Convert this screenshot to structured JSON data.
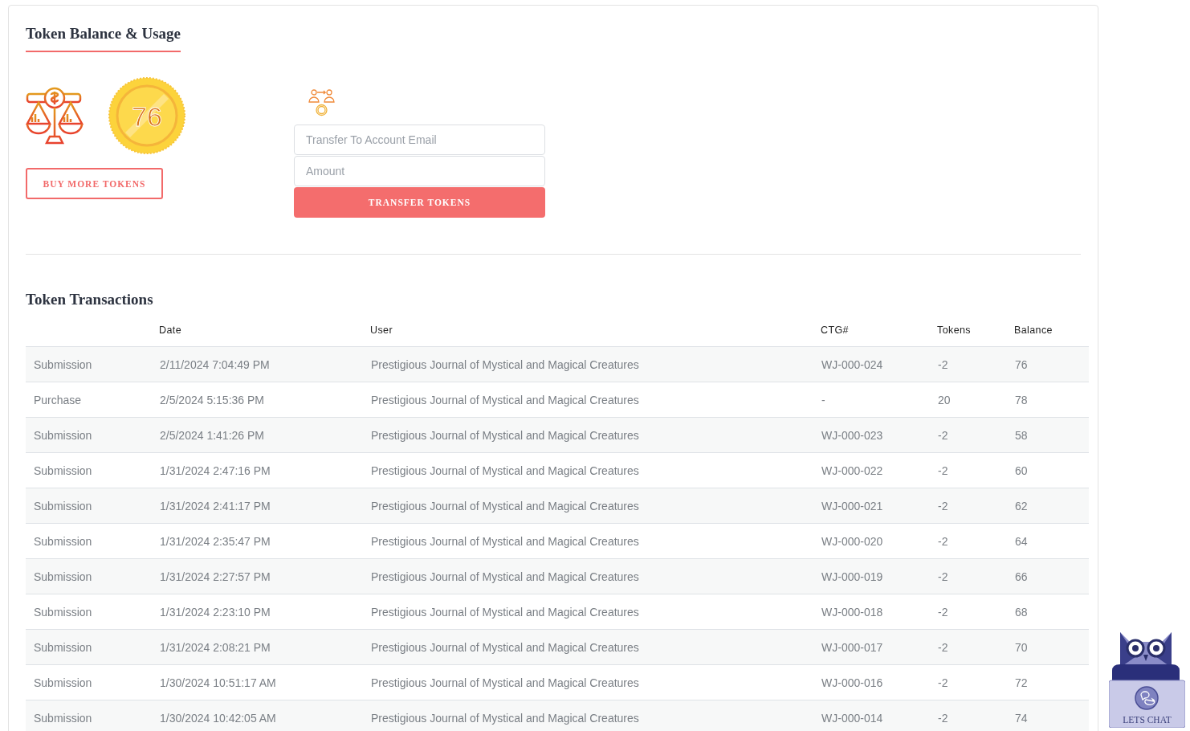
{
  "balance_section": {
    "title": "Token Balance & Usage",
    "balance": "76",
    "buy_button": "BUY MORE TOKENS"
  },
  "transfer": {
    "email_placeholder": "Transfer To Account Email",
    "amount_placeholder": "Amount",
    "button": "TRANSFER TOKENS"
  },
  "transactions": {
    "title": "Token Transactions",
    "columns": [
      "Date",
      "User",
      "CTG#",
      "Tokens",
      "Balance"
    ],
    "rows": [
      {
        "type": "Submission",
        "date": "2/11/2024 7:04:49 PM",
        "user": "Prestigious Journal of Mystical and Magical Creatures",
        "ctg": "WJ-000-024",
        "tokens": "-2",
        "balance": "76"
      },
      {
        "type": "Purchase",
        "date": "2/5/2024 5:15:36 PM",
        "user": "Prestigious Journal of Mystical and Magical Creatures",
        "ctg": "-",
        "tokens": "20",
        "balance": "78"
      },
      {
        "type": "Submission",
        "date": "2/5/2024 1:41:26 PM",
        "user": "Prestigious Journal of Mystical and Magical Creatures",
        "ctg": "WJ-000-023",
        "tokens": "-2",
        "balance": "58"
      },
      {
        "type": "Submission",
        "date": "1/31/2024 2:47:16 PM",
        "user": "Prestigious Journal of Mystical and Magical Creatures",
        "ctg": "WJ-000-022",
        "tokens": "-2",
        "balance": "60"
      },
      {
        "type": "Submission",
        "date": "1/31/2024 2:41:17 PM",
        "user": "Prestigious Journal of Mystical and Magical Creatures",
        "ctg": "WJ-000-021",
        "tokens": "-2",
        "balance": "62"
      },
      {
        "type": "Submission",
        "date": "1/31/2024 2:35:47 PM",
        "user": "Prestigious Journal of Mystical and Magical Creatures",
        "ctg": "WJ-000-020",
        "tokens": "-2",
        "balance": "64"
      },
      {
        "type": "Submission",
        "date": "1/31/2024 2:27:57 PM",
        "user": "Prestigious Journal of Mystical and Magical Creatures",
        "ctg": "WJ-000-019",
        "tokens": "-2",
        "balance": "66"
      },
      {
        "type": "Submission",
        "date": "1/31/2024 2:23:10 PM",
        "user": "Prestigious Journal of Mystical and Magical Creatures",
        "ctg": "WJ-000-018",
        "tokens": "-2",
        "balance": "68"
      },
      {
        "type": "Submission",
        "date": "1/31/2024 2:08:21 PM",
        "user": "Prestigious Journal of Mystical and Magical Creatures",
        "ctg": "WJ-000-017",
        "tokens": "-2",
        "balance": "70"
      },
      {
        "type": "Submission",
        "date": "1/30/2024 10:51:17 AM",
        "user": "Prestigious Journal of Mystical and Magical Creatures",
        "ctg": "WJ-000-016",
        "tokens": "-2",
        "balance": "72"
      },
      {
        "type": "Submission",
        "date": "1/30/2024 10:42:05 AM",
        "user": "Prestigious Journal of Mystical and Magical Creatures",
        "ctg": "WJ-000-014",
        "tokens": "-2",
        "balance": "74"
      }
    ]
  },
  "chat_widget": {
    "label": "LETS CHAT"
  }
}
